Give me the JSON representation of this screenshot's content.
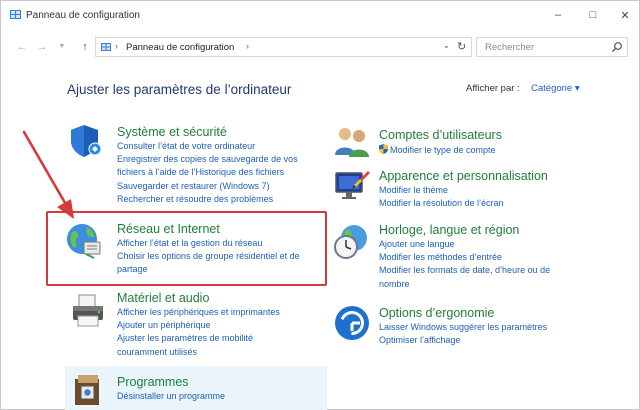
{
  "window": {
    "title": "Panneau de configuration",
    "controls": {
      "minimize": "–",
      "maximize": "□",
      "close": "✕"
    }
  },
  "address": {
    "path": "Panneau de configuration",
    "separator": "›",
    "search_placeholder": "Rechercher"
  },
  "header": {
    "heading": "Ajuster les paramètres de l’ordinateur",
    "view_by_label": "Afficher par :",
    "view_by_value": "Catégorie ▾"
  },
  "categories": {
    "system": {
      "title": "Système et sécurité",
      "icon": "shield-icon",
      "links": [
        "Consulter l’état de votre ordinateur",
        "Enregistrer des copies de sauvegarde de vos",
        "fichiers à l’aide de l’Historique des fichiers",
        "Sauvegarder et restaurer (Windows 7)",
        "Rechercher et résoudre des problèmes"
      ]
    },
    "network": {
      "title": "Réseau et Internet",
      "icon": "network-globe-icon",
      "links": [
        "Afficher l’état et la gestion du réseau",
        "Choisir les options de groupe résidentiel et de",
        "partage"
      ]
    },
    "hardware": {
      "title": "Matériel et audio",
      "icon": "printer-icon",
      "links": [
        "Afficher les périphériques et imprimantes",
        "Ajouter un périphérique",
        "Ajuster les paramètres de mobilité",
        "couramment utilisés"
      ]
    },
    "programs": {
      "title": "Programmes",
      "icon": "programs-icon",
      "links": [
        "Désinstaller un programme"
      ]
    },
    "accounts": {
      "title": "Comptes d’utilisateurs",
      "icon": "users-icon",
      "links": [
        "Modifier le type de compte"
      ]
    },
    "appearance": {
      "title": "Apparence et personnalisation",
      "icon": "display-icon",
      "links": [
        "Modifier le thème",
        "Modifier la résolution de l’écran"
      ]
    },
    "clock": {
      "title": "Horloge, langue et région",
      "icon": "clock-globe-icon",
      "links": [
        "Ajouter une langue",
        "Modifier les méthodes d’entrée",
        "Modifier les formats de date, d’heure ou de",
        "nombre"
      ]
    },
    "ease": {
      "title": "Options d’ergonomie",
      "icon": "ease-of-access-icon",
      "links": [
        "Laisser Windows suggérer les paramètres",
        "Optimiser l’affichage"
      ]
    }
  },
  "colors": {
    "link": "#2060b8",
    "category_title": "#1f7f3a",
    "heading": "#1e3b70",
    "highlight": "#d33a3a"
  }
}
